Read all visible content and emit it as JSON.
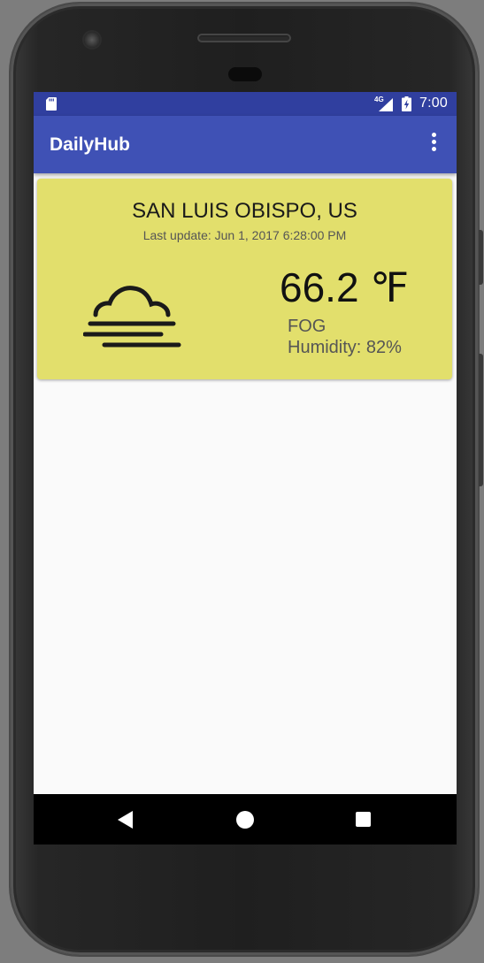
{
  "status_bar": {
    "network_label": "4G",
    "time": "7:00",
    "icons": [
      "sd-card-icon",
      "cell-signal-icon",
      "battery-charging-icon"
    ]
  },
  "app_bar": {
    "title": "DailyHub",
    "overflow_icon": "more-vert-icon",
    "color": "#3f51b5",
    "status_color": "#303f9f"
  },
  "weather_card": {
    "city": "SAN LUIS OBISPO, US",
    "last_update": "Last update: Jun 1, 2017 6:28:00 PM",
    "temperature": "66.2 ℉",
    "condition": "FOG",
    "humidity": "Humidity: 82%",
    "icon": "fog-icon",
    "background": "#e2df6c"
  },
  "nav_bar": {
    "icons": [
      "back-icon",
      "home-icon",
      "recents-icon"
    ]
  }
}
